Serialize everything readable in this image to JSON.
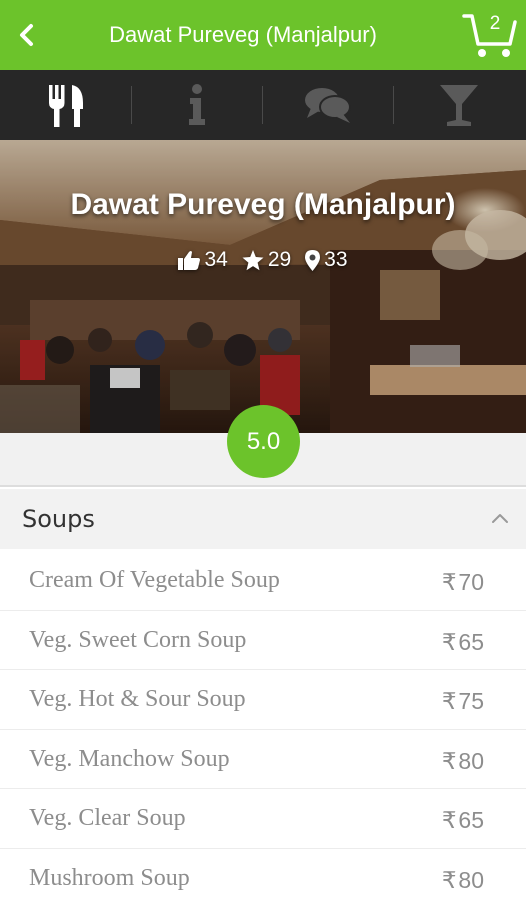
{
  "appbar": {
    "back_icon": "chevron-left-icon",
    "title": "Dawat Pureveg (Manjalpur)",
    "cart_icon": "cart-icon",
    "cart_count": "2",
    "color": "#6cc32b"
  },
  "tabs": [
    {
      "icon": "fork-knife-icon",
      "active": true
    },
    {
      "icon": "info-icon",
      "active": false
    },
    {
      "icon": "chat-bubbles-icon",
      "active": false
    },
    {
      "icon": "cocktail-glass-icon",
      "active": false
    }
  ],
  "hero": {
    "title": "Dawat Pureveg (Manjalpur)",
    "likes": "34",
    "stars": "29",
    "checkins": "33"
  },
  "rating": "5.0",
  "section": {
    "title": "Soups",
    "icon": "chevron-up-icon"
  },
  "currency": "₹",
  "items": [
    {
      "name": "Cream Of Vegetable Soup",
      "price": "70"
    },
    {
      "name": "Veg. Sweet Corn Soup",
      "price": "65"
    },
    {
      "name": "Veg. Hot & Sour Soup",
      "price": "75"
    },
    {
      "name": "Veg. Manchow Soup",
      "price": "80"
    },
    {
      "name": "Veg. Clear Soup",
      "price": "65"
    },
    {
      "name": "Mushroom Soup",
      "price": "80"
    }
  ]
}
